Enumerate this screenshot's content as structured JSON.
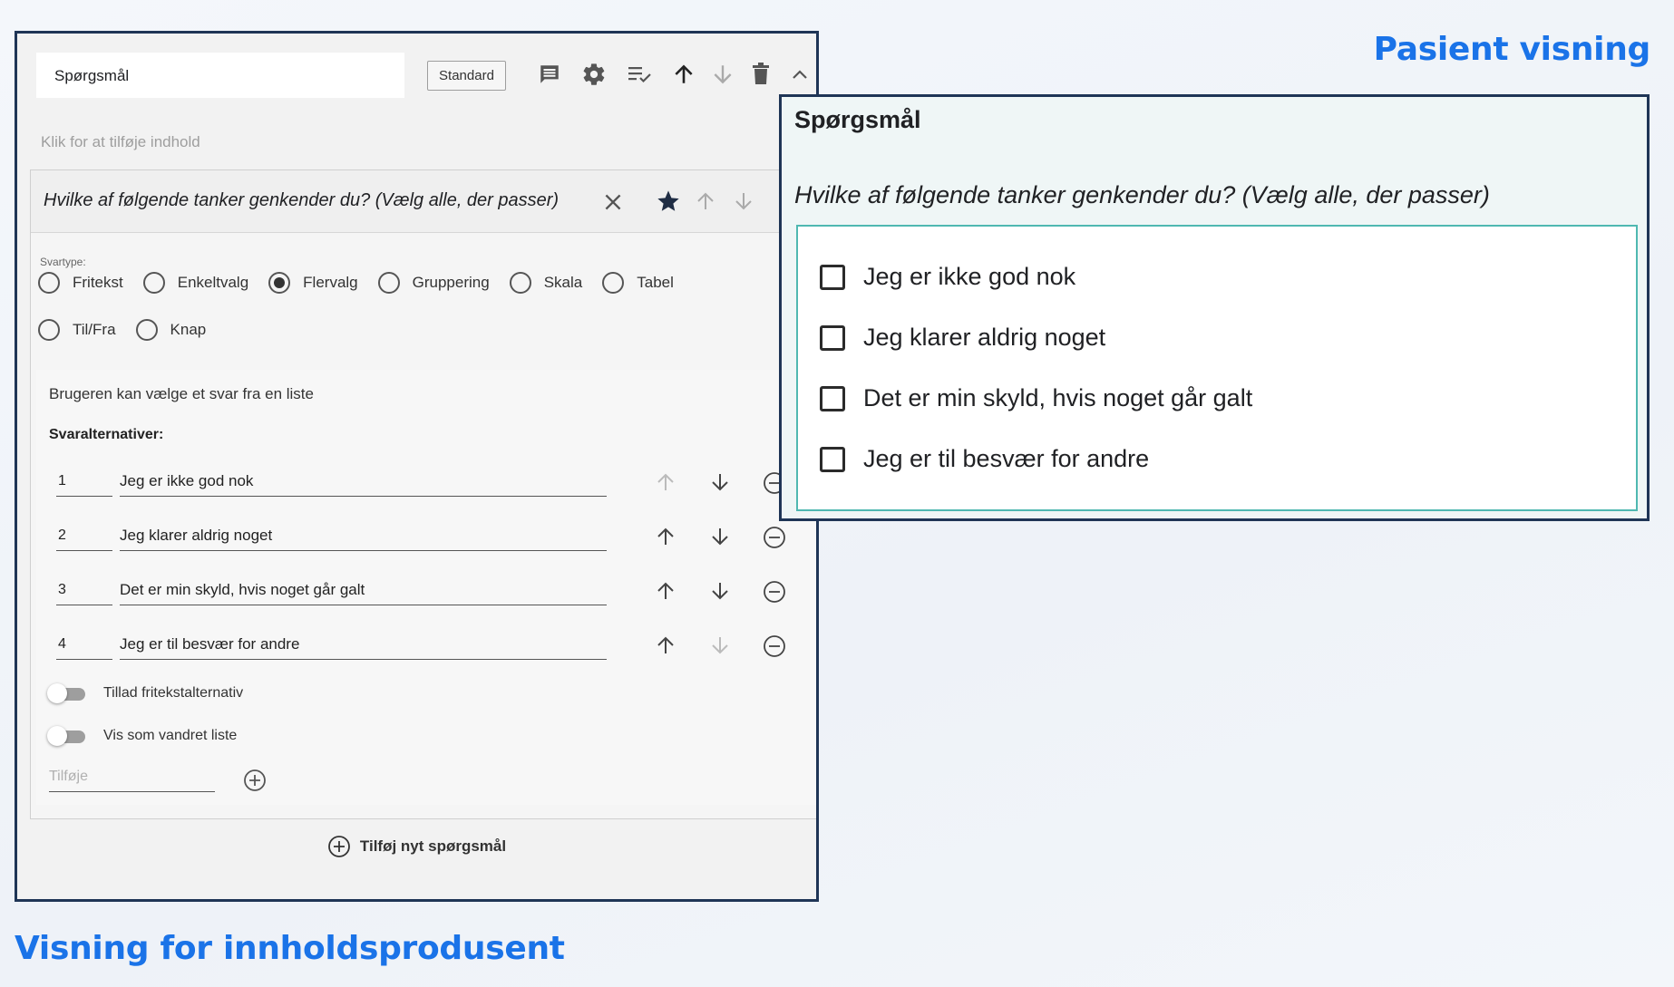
{
  "captions": {
    "patient_view": "Pasient visning",
    "producer_view": "Visning for innholdsprodusent"
  },
  "editor": {
    "title_value": "Spørgsmål",
    "standard_button": "Standard",
    "toolbar_icons": [
      "comment-icon",
      "gear-icon",
      "sort-list-icon",
      "arrow-up-icon",
      "arrow-down-icon",
      "trash-icon",
      "chevron-up-icon"
    ],
    "add_content_hint": "Klik for at tilføje indhold",
    "question": {
      "text": "Hvilke af følgende tanker genkender du? (Vælg alle, der passer)",
      "answer_type_label": "Svartype:",
      "answer_types": [
        {
          "label": "Fritekst",
          "selected": false
        },
        {
          "label": "Enkeltvalg",
          "selected": false
        },
        {
          "label": "Flervalg",
          "selected": true
        },
        {
          "label": "Gruppering",
          "selected": false
        },
        {
          "label": "Skala",
          "selected": false
        },
        {
          "label": "Tabel",
          "selected": false
        },
        {
          "label": "Til/Fra",
          "selected": false
        },
        {
          "label": "Knap",
          "selected": false
        }
      ],
      "description": "Brugeren kan vælge et svar fra en liste",
      "alternatives_label": "Svaralternativer:",
      "alternatives": [
        {
          "number": "1",
          "text": "Jeg er ikke god nok"
        },
        {
          "number": "2",
          "text": "Jeg klarer aldrig noget"
        },
        {
          "number": "3",
          "text": "Det er min skyld, hvis noget går galt"
        },
        {
          "number": "4",
          "text": "Jeg er til besvær for andre"
        }
      ],
      "toggles": [
        {
          "label": "Tillad fritekstalternativ",
          "on": false
        },
        {
          "label": "Vis som vandret liste",
          "on": false
        }
      ],
      "add_placeholder": "Tilføje"
    },
    "add_new_question": "Tilføj nyt spørgsmål"
  },
  "patient": {
    "title": "Spørgsmål",
    "question": "Hvilke af følgende tanker genkender du? (Vælg alle, der passer)",
    "options": [
      "Jeg er ikke god nok",
      "Jeg klarer aldrig noget",
      "Det er min skyld, hvis noget går galt",
      "Jeg er til besvær for andre"
    ]
  }
}
